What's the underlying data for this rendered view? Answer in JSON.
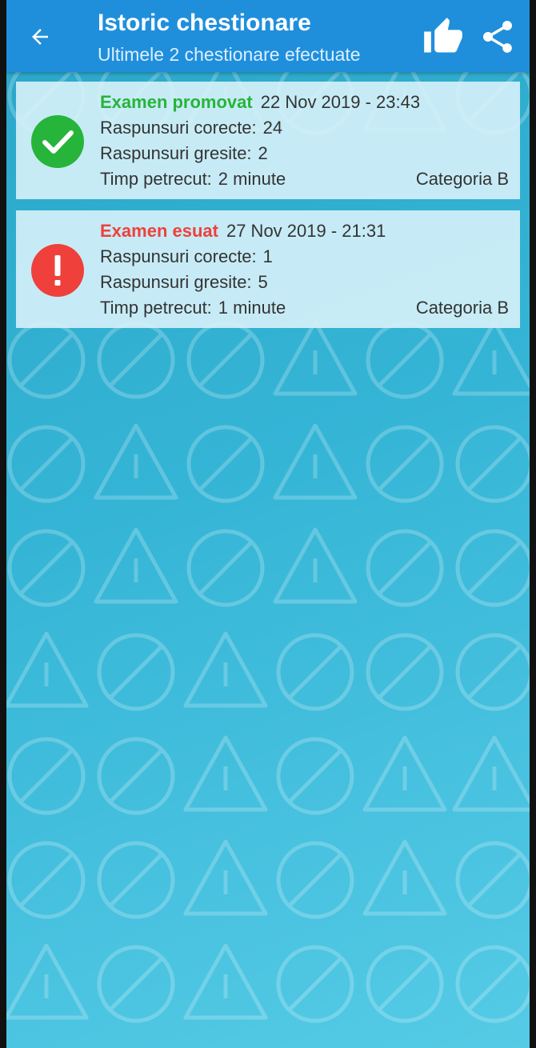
{
  "appbar": {
    "title": "Istoric chestionare",
    "subtitle": "Ultimele 2 chestionare efectuate",
    "back_icon": "arrow-left-icon",
    "like_icon": "thumbs-up-icon",
    "share_icon": "share-icon",
    "background_color": "#1f8fdc"
  },
  "quizzes": [
    {
      "status": "Examen promovat",
      "status_color": "#27b43a",
      "status_icon": "check-circle-icon",
      "date": "22 Nov 2019 - 23:43",
      "correct_label": "Raspunsuri corecte:",
      "correct_value": "24",
      "wrong_label": "Raspunsuri gresite:",
      "wrong_value": "2",
      "time_label": "Timp petrecut:",
      "time_value": "2 minute",
      "category": "Categoria B"
    },
    {
      "status": "Examen esuat",
      "status_color": "#f0403c",
      "status_icon": "exclamation-circle-icon",
      "date": "27 Nov 2019 - 21:31",
      "correct_label": "Raspunsuri corecte:",
      "correct_value": "1",
      "wrong_label": "Raspunsuri gresite:",
      "wrong_value": "5",
      "time_label": "Timp petrecut:",
      "time_value": "1 minute",
      "category": "Categoria B"
    }
  ]
}
